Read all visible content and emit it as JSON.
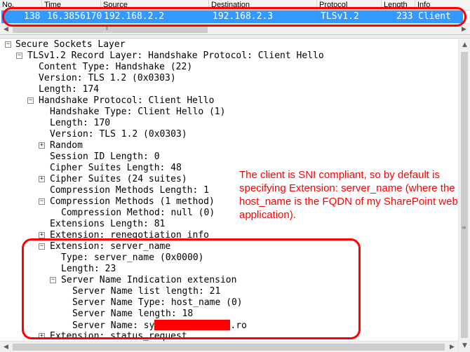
{
  "packet_list": {
    "columns": [
      "No.",
      "Time",
      "Source",
      "Destination",
      "Protocol",
      "Length",
      "Info"
    ],
    "selected_row": {
      "no": "138",
      "time": "16.3856170",
      "source": "192.168.2.2",
      "destination": "192.168.2.3",
      "protocol": "TLSv1.2",
      "length": "233",
      "info": "Client"
    }
  },
  "details": {
    "l0": "Secure Sockets Layer",
    "l1": "TLSv1.2 Record Layer: Handshake Protocol: Client Hello",
    "l2": "Content Type: Handshake (22)",
    "l3": "Version: TLS 1.2 (0x0303)",
    "l4": "Length: 174",
    "l5": "Handshake Protocol: Client Hello",
    "l6": "Handshake Type: Client Hello (1)",
    "l7": "Length: 170",
    "l8": "Version: TLS 1.2 (0x0303)",
    "l9": "Random",
    "l10": "Session ID Length: 0",
    "l11": "Cipher Suites Length: 48",
    "l12": "Cipher Suites (24 suites)",
    "l13": "Compression Methods Length: 1",
    "l14": "Compression Methods (1 method)",
    "l15": "Compression Method: null (0)",
    "l16": "Extensions Length: 81",
    "l17": "Extension: renegotiation_info",
    "l18": "Extension: server_name",
    "l19": "Type: server_name (0x0000)",
    "l20": "Length: 23",
    "l21": "Server Name Indication extension",
    "l22": "Server Name list length: 21",
    "l23": "Server Name Type: host_name (0)",
    "l24": "Server Name length: 18",
    "l25_prefix": "Server Name: sy",
    "l25_suffix": ".ro",
    "l26": "Extension: status_request"
  },
  "annotation": "The client is SNI compliant, so by default is specifying Extension: server_name (where the host_name is the FQDN of my SharePoint web application).",
  "colors": {
    "selection": "#3399ff",
    "annotation": "#ff0000"
  },
  "icons": [
    "expand-plus-icon",
    "collapse-minus-icon",
    "scroll-left-arrow-icon",
    "scroll-right-arrow-icon",
    "scroll-up-arrow-icon",
    "scroll-down-arrow-icon",
    "scroll-grip-icon"
  ]
}
